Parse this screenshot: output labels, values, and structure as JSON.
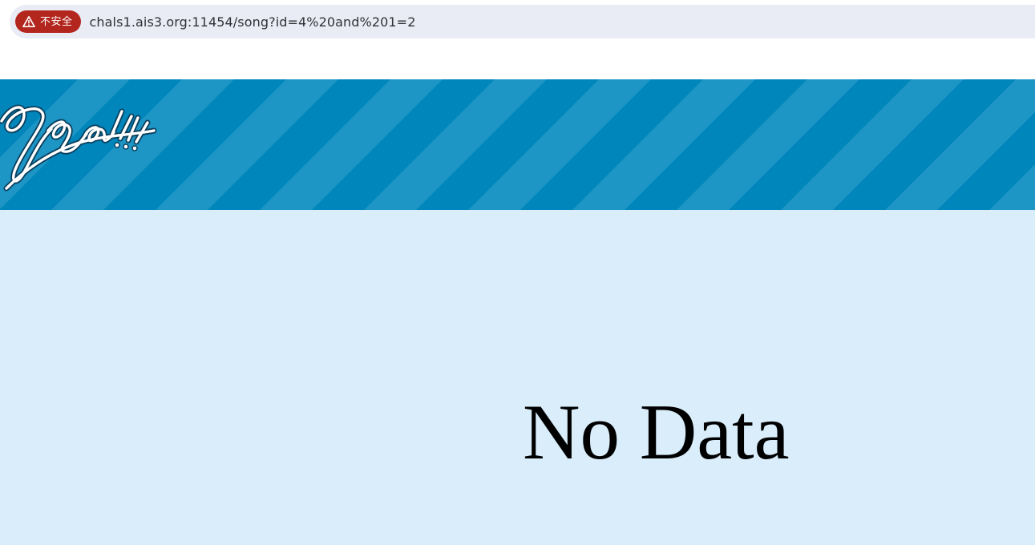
{
  "browser": {
    "security_label": "不安全",
    "security_icon": "warning-triangle-icon",
    "url": "chals1.ais3.org:11454/song?id=4%20and%201=2"
  },
  "banner": {
    "background_color": "#0086bb",
    "stripe_color": "#1d95c5",
    "logo_icon": "signature-logo-icon"
  },
  "main": {
    "background_color": "#d9edfa",
    "message": "No Data"
  }
}
